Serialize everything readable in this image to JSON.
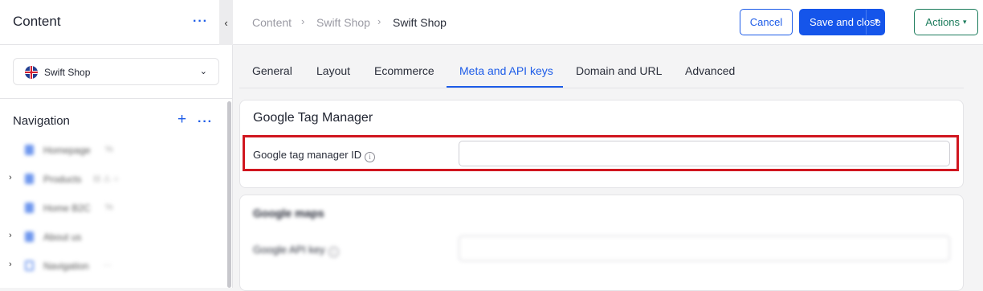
{
  "sidebar": {
    "title": "Content",
    "site_selector": {
      "value": "Swift Shop"
    },
    "navigation_title": "Navigation",
    "tree": [
      {
        "label": "Homepage",
        "extra": "%"
      },
      {
        "label": "Products",
        "extra": "⊟ ⚠ ○"
      },
      {
        "label": "Home B2C",
        "extra": "%"
      },
      {
        "label": "About us",
        "extra": ""
      },
      {
        "label": "Navigation",
        "extra": "···"
      }
    ]
  },
  "breadcrumb": [
    "Content",
    "Swift Shop",
    "Swift Shop"
  ],
  "toolbar": {
    "cancel_label": "Cancel",
    "save_label": "Save and close",
    "actions_label": "Actions"
  },
  "tabs": [
    "General",
    "Layout",
    "Ecommerce",
    "Meta and API keys",
    "Domain and URL",
    "Advanced"
  ],
  "active_tab": "Meta and API keys",
  "gtm_card": {
    "title": "Google Tag Manager",
    "field_label": "Google tag manager ID",
    "field_value": ""
  },
  "maps_card": {
    "title": "Google maps",
    "field_label": "Google API key",
    "field_value": ""
  },
  "colors": {
    "accent": "#1d5ce8",
    "actions": "#1c7c5c",
    "highlight": "#d0161f"
  },
  "icons": [
    "more-dots-icon",
    "collapse-chevron-icon",
    "uk-flag-icon",
    "chevron-down-icon",
    "plus-icon",
    "info-icon",
    "page-icon"
  ]
}
